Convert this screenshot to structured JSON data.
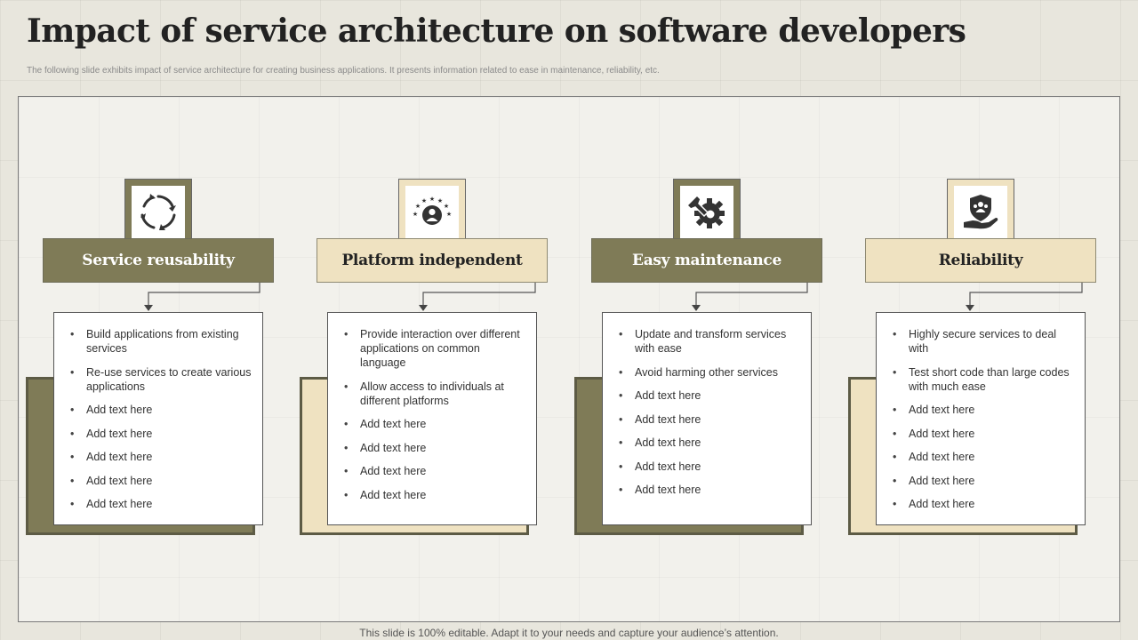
{
  "title": "Impact of service architecture on software developers",
  "subtitle": "The following slide exhibits impact of service architecture for creating business applications. It presents information related to ease in maintenance, reliability, etc.",
  "footer": "This slide is 100% editable. Adapt it to your needs and capture your audience’s attention.",
  "colors": {
    "dark": "#7f7b57",
    "light": "#efe2c1",
    "background": "#e8e6dd"
  },
  "cards": [
    {
      "heading": "Service reusability",
      "icon": "recycle-arrows-icon",
      "theme": "dark",
      "bullets": [
        "Build applications from existing services",
        "Re-use services to create various applications",
        "Add text here",
        "Add text here",
        "Add text here",
        "Add text here",
        "Add text here"
      ]
    },
    {
      "heading": "Platform independent",
      "icon": "user-stars-icon",
      "theme": "light",
      "bullets": [
        "Provide interaction over different applications on common language",
        "Allow access to individuals at different platforms",
        "Add text here",
        "Add text here",
        "Add text here",
        "Add text here"
      ]
    },
    {
      "heading": "Easy maintenance",
      "icon": "gear-wrench-icon",
      "theme": "dark",
      "bullets": [
        "Update and transform services with ease",
        "Avoid harming other services",
        "Add text here",
        "Add text here",
        "Add text here",
        "Add text here",
        "Add text here"
      ]
    },
    {
      "heading": "Reliability",
      "icon": "shield-hand-icon",
      "theme": "light",
      "bullets": [
        "Highly secure services to deal with",
        "Test short code than large codes with much ease",
        "Add text here",
        "Add text here",
        "Add text here",
        "Add text here",
        "Add text here"
      ]
    }
  ]
}
